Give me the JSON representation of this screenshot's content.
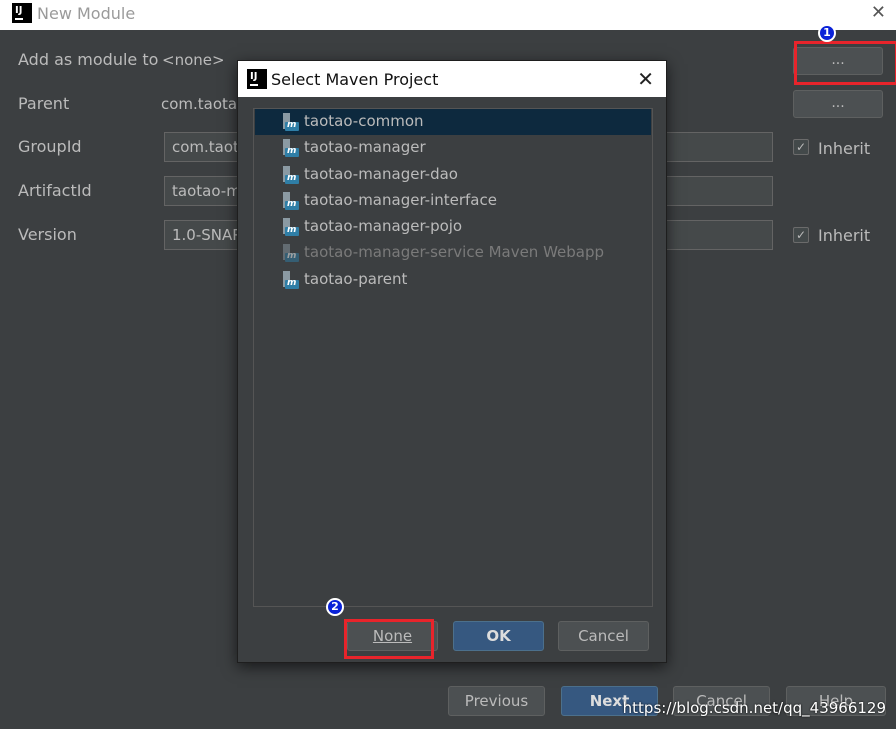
{
  "window": {
    "title": "New Module"
  },
  "form": {
    "add_as_module_label": "Add as module to",
    "add_as_module_value": "<none>",
    "parent_label": "Parent",
    "parent_value": "com.taota",
    "groupid_label": "GroupId",
    "groupid_value": "com.taot",
    "artifactid_label": "ArtifactId",
    "artifactid_value": "taotao-m",
    "version_label": "Version",
    "version_value": "1.0-SNAP",
    "browse_label": "...",
    "inherit_label": "Inherit",
    "inherit_groupid_checked": true,
    "inherit_version_checked": true
  },
  "markers": {
    "one": "1",
    "two": "2"
  },
  "footer": {
    "previous_label": "Previous",
    "next_label": "Next",
    "cancel_label": "Cancel",
    "help_label": "Help"
  },
  "watermark": "https://blog.csdn.net/qq_43966129",
  "dialog": {
    "title": "Select Maven Project",
    "items": [
      {
        "label": "taotao-common",
        "selected": true,
        "enabled": true
      },
      {
        "label": "taotao-manager",
        "selected": false,
        "enabled": true
      },
      {
        "label": "taotao-manager-dao",
        "selected": false,
        "enabled": true
      },
      {
        "label": "taotao-manager-interface",
        "selected": false,
        "enabled": true
      },
      {
        "label": "taotao-manager-pojo",
        "selected": false,
        "enabled": true
      },
      {
        "label": "taotao-manager-service Maven Webapp",
        "selected": false,
        "enabled": false
      },
      {
        "label": "taotao-parent",
        "selected": false,
        "enabled": true
      }
    ],
    "none_label": "None",
    "ok_label": "OK",
    "cancel_label": "Cancel"
  },
  "colors": {
    "background": "#3c3f41",
    "selection": "#0d293e",
    "primary_button": "#365880",
    "highlight": "#e8242b"
  }
}
